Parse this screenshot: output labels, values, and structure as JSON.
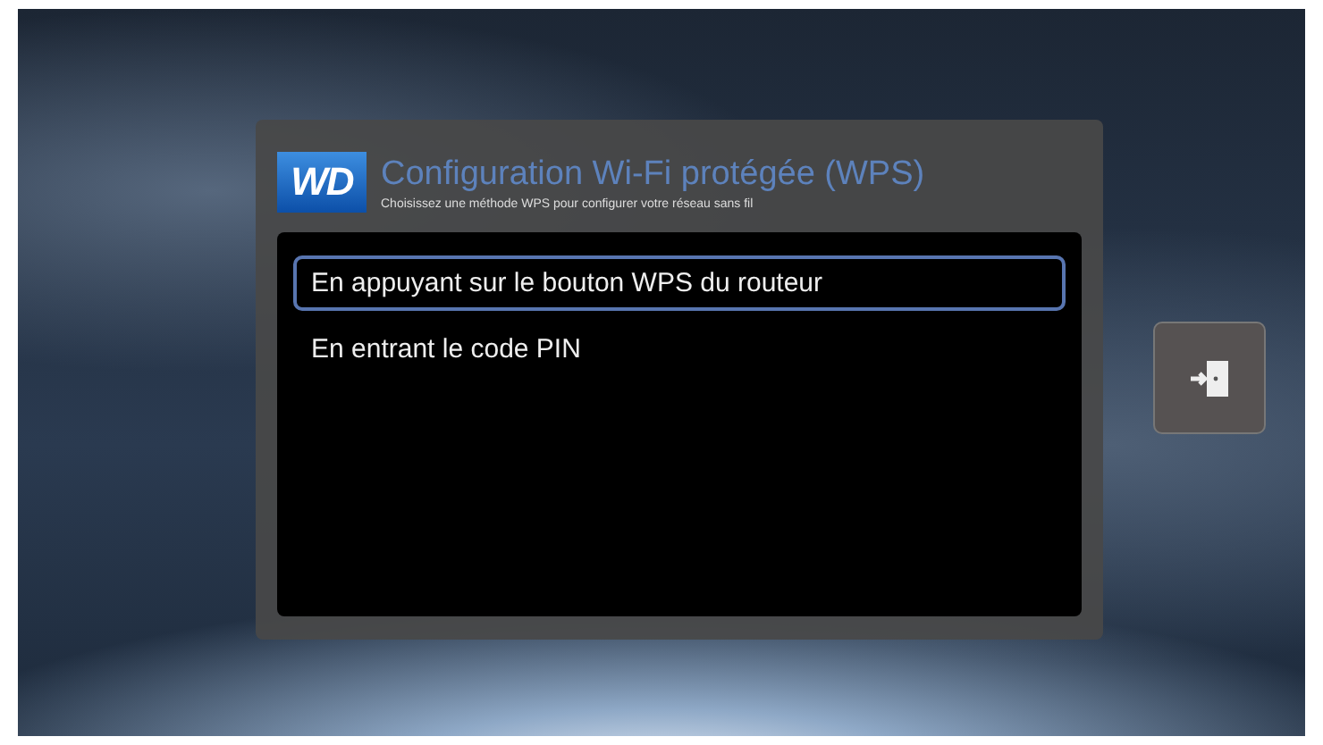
{
  "dialog": {
    "logo": "WD",
    "title": "Configuration Wi-Fi protégée (WPS)",
    "subtitle": "Choisissez une méthode WPS pour configurer votre réseau sans fil",
    "options": [
      {
        "label": "En appuyant sur le bouton WPS du routeur",
        "selected": true
      },
      {
        "label": "En entrant le code PIN",
        "selected": false
      }
    ]
  }
}
